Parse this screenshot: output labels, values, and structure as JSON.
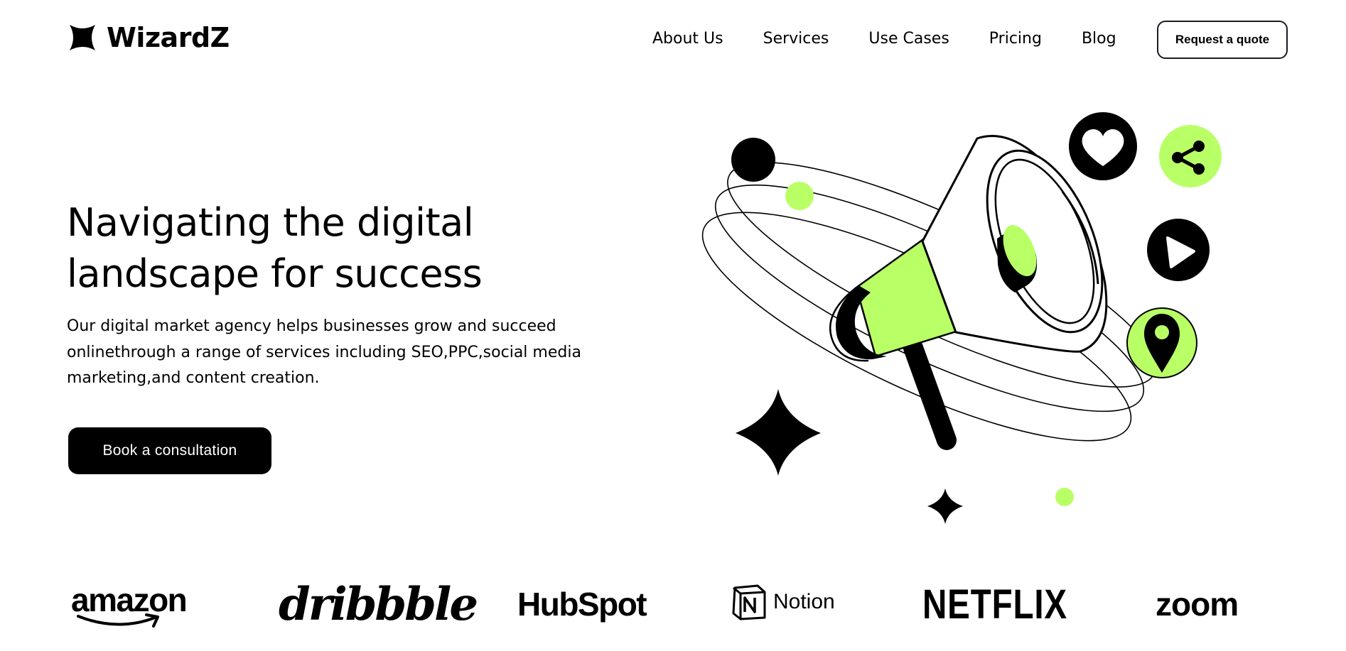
{
  "header": {
    "brand_name": "WizardZ",
    "logo_icon": "four-point-star-icon",
    "nav_items": [
      "About Us",
      "Services",
      "Use Cases",
      "Pricing",
      "Blog"
    ],
    "cta_label": "Request a quote"
  },
  "hero": {
    "title_lines": [
      "Navigating the digital",
      "landscape for success"
    ],
    "description_lines": [
      "Our digital market agency helps businesses grow and succeed",
      "onlinethrough a range of services including SEO,PPC,social media",
      "marketing,and content creation."
    ],
    "cta_label": "Book a consultation",
    "illustration_icons": [
      "megaphone-icon",
      "heart-icon",
      "share-icon",
      "play-icon",
      "location-pin-icon",
      "sparkle-star-icon"
    ]
  },
  "brands": {
    "logos": [
      "amazon",
      "dribbble",
      "HubSpot",
      "Notion",
      "NETFLIX",
      "zoom"
    ]
  },
  "colors": {
    "accent": "#b9ff66",
    "dark": "#000000",
    "background": "#ffffff"
  }
}
